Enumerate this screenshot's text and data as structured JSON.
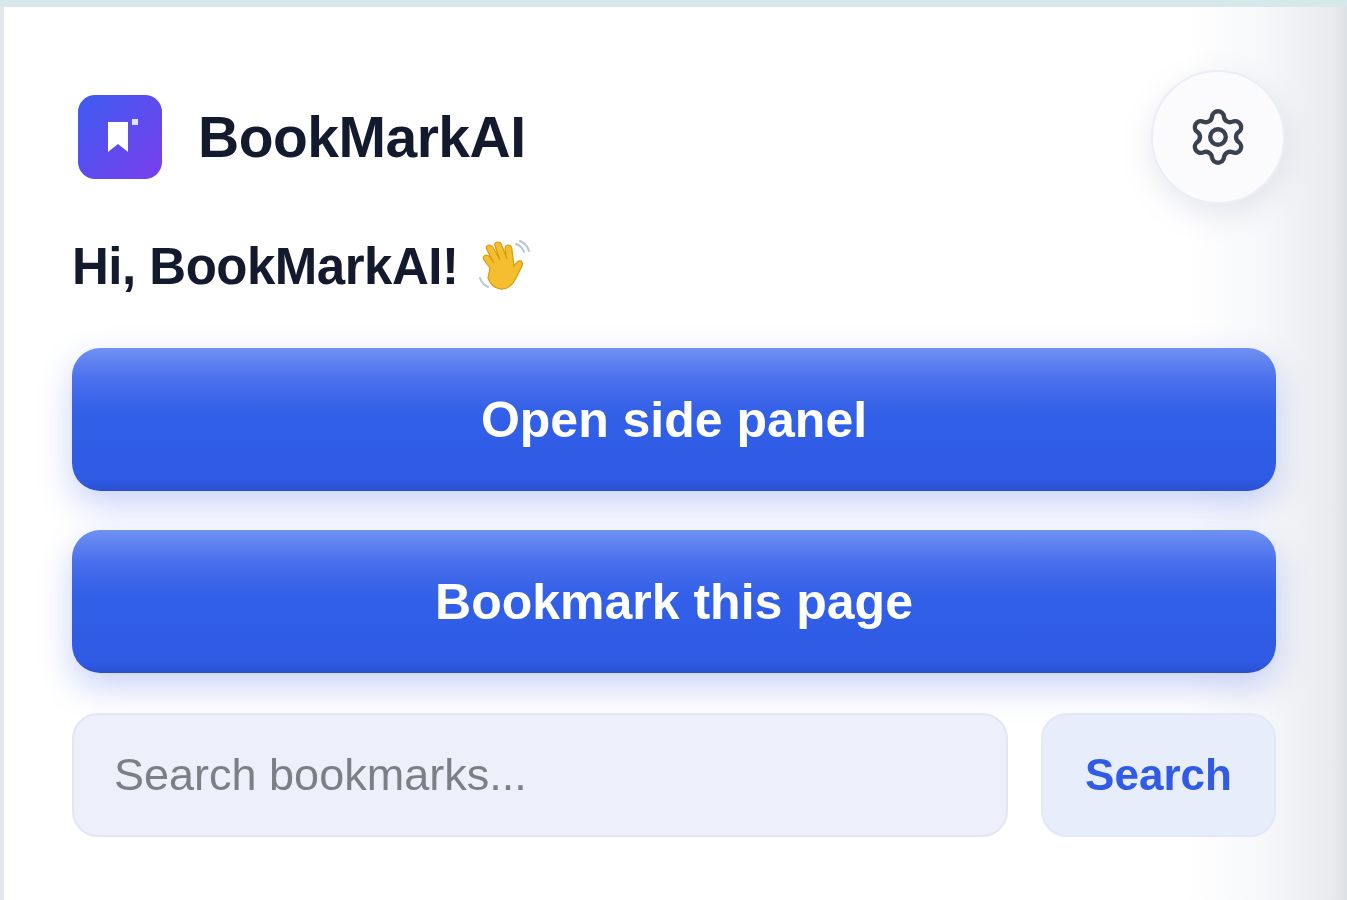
{
  "header": {
    "app_name": "BookMarkAI"
  },
  "greeting": "Hi, BookMarkAI!",
  "actions": [
    {
      "label": "Open side panel"
    },
    {
      "label": "Bookmark this page"
    }
  ],
  "search": {
    "placeholder": "Search bookmarks...",
    "button": "Search"
  }
}
